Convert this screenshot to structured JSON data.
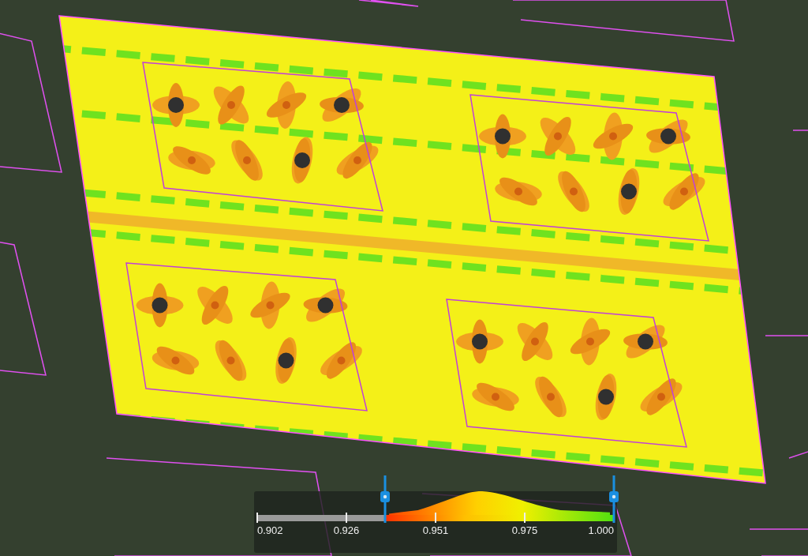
{
  "legend": {
    "ticks": [
      "0.902",
      "0.926",
      "0.951",
      "0.975",
      "1.000"
    ],
    "handles": [
      {
        "level": 0.358
      },
      {
        "level": 1
      }
    ]
  }
}
